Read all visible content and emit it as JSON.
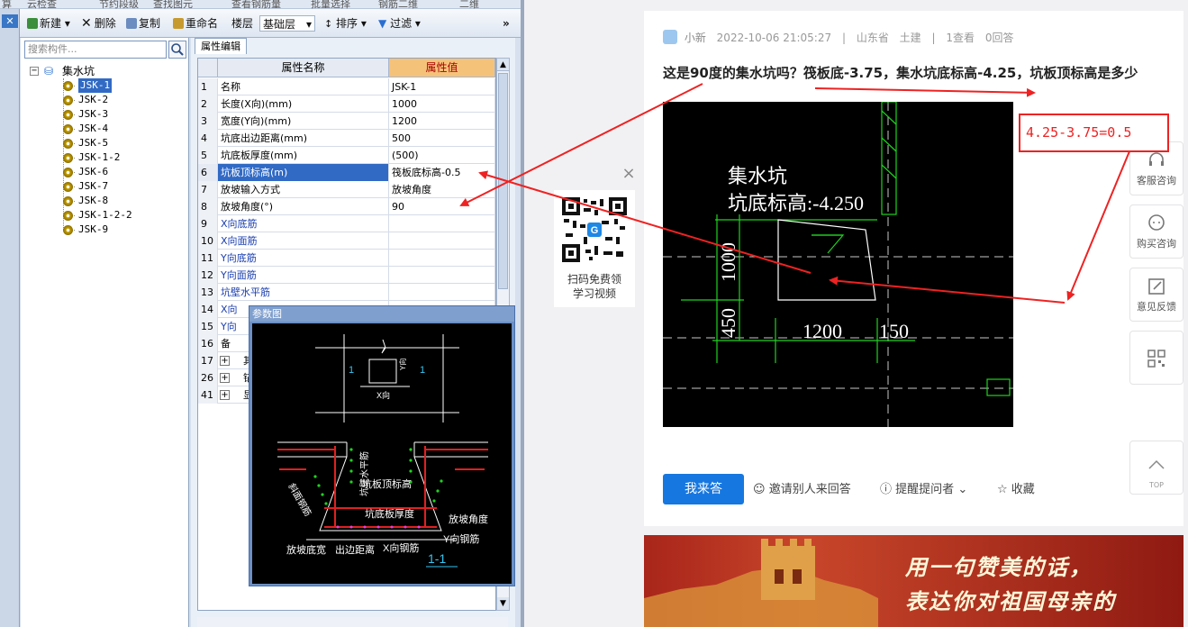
{
  "toolbar": {
    "new": "新建",
    "delete": "删除",
    "copy": "复制",
    "rename": "重命名",
    "floor_label": "楼层",
    "floor_value": "基础层",
    "sort": "排序",
    "filter": "过滤",
    "top_cut": [
      "算",
      "云检查",
      "节约段级",
      "查找图元",
      "查看钢筋量",
      "批量选择",
      "钢筋二维",
      "二维"
    ]
  },
  "tree": {
    "search_placeholder": "搜索构件...",
    "root": "集水坑",
    "items": [
      "JSK-1",
      "JSK-2",
      "JSK-3",
      "JSK-4",
      "JSK-5",
      "JSK-1-2",
      "JSK-6",
      "JSK-7",
      "JSK-8",
      "JSK-1-2-2",
      "JSK-9"
    ],
    "selected": "JSK-1"
  },
  "props": {
    "tab": "属性编辑",
    "col_name": "属性名称",
    "col_value": "属性值",
    "rows": [
      {
        "n": "1",
        "name": "名称",
        "value": "JSK-1"
      },
      {
        "n": "2",
        "name": "长度(X向)(mm)",
        "value": "1000"
      },
      {
        "n": "3",
        "name": "宽度(Y向)(mm)",
        "value": "1200"
      },
      {
        "n": "4",
        "name": "坑底出边距离(mm)",
        "value": "500"
      },
      {
        "n": "5",
        "name": "坑底板厚度(mm)",
        "value": "(500)"
      },
      {
        "n": "6",
        "name": "坑板顶标高(m)",
        "value": "筏板底标高-0.5"
      },
      {
        "n": "7",
        "name": "放坡输入方式",
        "value": "放坡角度"
      },
      {
        "n": "8",
        "name": "放坡角度(°)",
        "value": "90"
      },
      {
        "n": "9",
        "name": "X向底筋",
        "value": ""
      },
      {
        "n": "10",
        "name": "X向面筋",
        "value": ""
      },
      {
        "n": "11",
        "name": "Y向底筋",
        "value": ""
      },
      {
        "n": "12",
        "name": "Y向面筋",
        "value": ""
      },
      {
        "n": "13",
        "name": "坑壁水平筋",
        "value": ""
      },
      {
        "n": "14",
        "name": "X向",
        "value": ""
      },
      {
        "n": "15",
        "name": "Y向",
        "value": ""
      },
      {
        "n": "16",
        "name": "备",
        "value": ""
      },
      {
        "n": "17",
        "name": "其",
        "value": ""
      },
      {
        "n": "26",
        "name": "锚",
        "value": ""
      },
      {
        "n": "41",
        "name": "显",
        "value": ""
      }
    ]
  },
  "param": {
    "title": "参数图",
    "labels": {
      "xdir": "X向",
      "ydir": "Y向",
      "wall_h": "坑壁水平筋",
      "top_elev": "坑板顶标高",
      "bottom_thick": "坑底板厚度",
      "slope_angle": "放坡角度",
      "ybar": "Y向钢筋",
      "slope_bar": "斜面钢筋",
      "slope_width": "放坡底宽",
      "out_dist": "出边距离",
      "xbar": "X向钢筋",
      "section": "1-1",
      "one": "1"
    }
  },
  "qr": {
    "caption1": "扫码免费领",
    "caption2": "学习视频",
    "close": "×"
  },
  "question": {
    "author": "小新",
    "time": "2022-10-06 21:05:27",
    "location": "山东省",
    "category": "土建",
    "views": "1查看",
    "answers": "0回答",
    "title": "这是90度的集水坑吗？筏板底-3.75，集水坑底标高-4.25，坑板顶标高是多少",
    "answer_btn": "我来答",
    "invite": "邀请别人来回答",
    "remind": "提醒提问者",
    "fav": "收藏"
  },
  "cad": {
    "line1": "集水坑",
    "line2": "坑底标高:-4.250",
    "dim1000": "1000",
    "dim450": "450",
    "dim1200": "1200",
    "dim150": "150"
  },
  "annotation": "4.25-3.75=0.5",
  "side": {
    "service": "客服咨询",
    "buy": "购买咨询",
    "feedback": "意见反馈",
    "top": "TOP"
  },
  "banner": {
    "line1": "用一句赞美的话，",
    "line2": "表达你对祖国母亲的"
  },
  "colors": {
    "accent": "#1677e0",
    "selection": "#316ac5",
    "annotation": "#e22222",
    "prop_header": "#f5c27a",
    "cad_green": "#1fd31f"
  }
}
